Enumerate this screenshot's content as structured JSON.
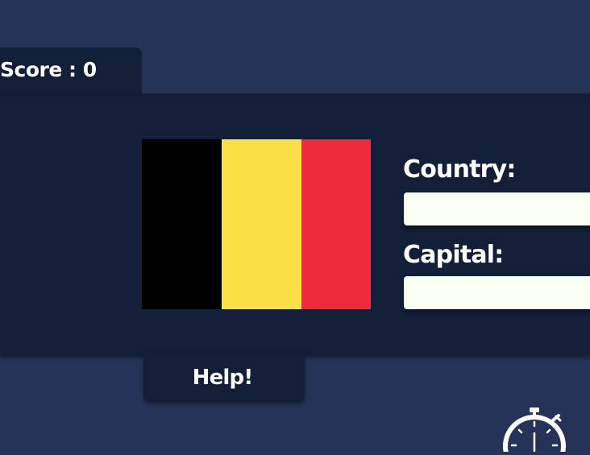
{
  "score": {
    "label": "Score : 0"
  },
  "flag": {
    "colors": [
      "#000000",
      "#fae042",
      "#ef2b3a"
    ]
  },
  "form": {
    "country_label": "Country:",
    "country_value": "",
    "capital_label": "Capital:",
    "capital_value": ""
  },
  "help": {
    "label": "Help!"
  },
  "icons": {
    "timer": "stopwatch-icon"
  }
}
